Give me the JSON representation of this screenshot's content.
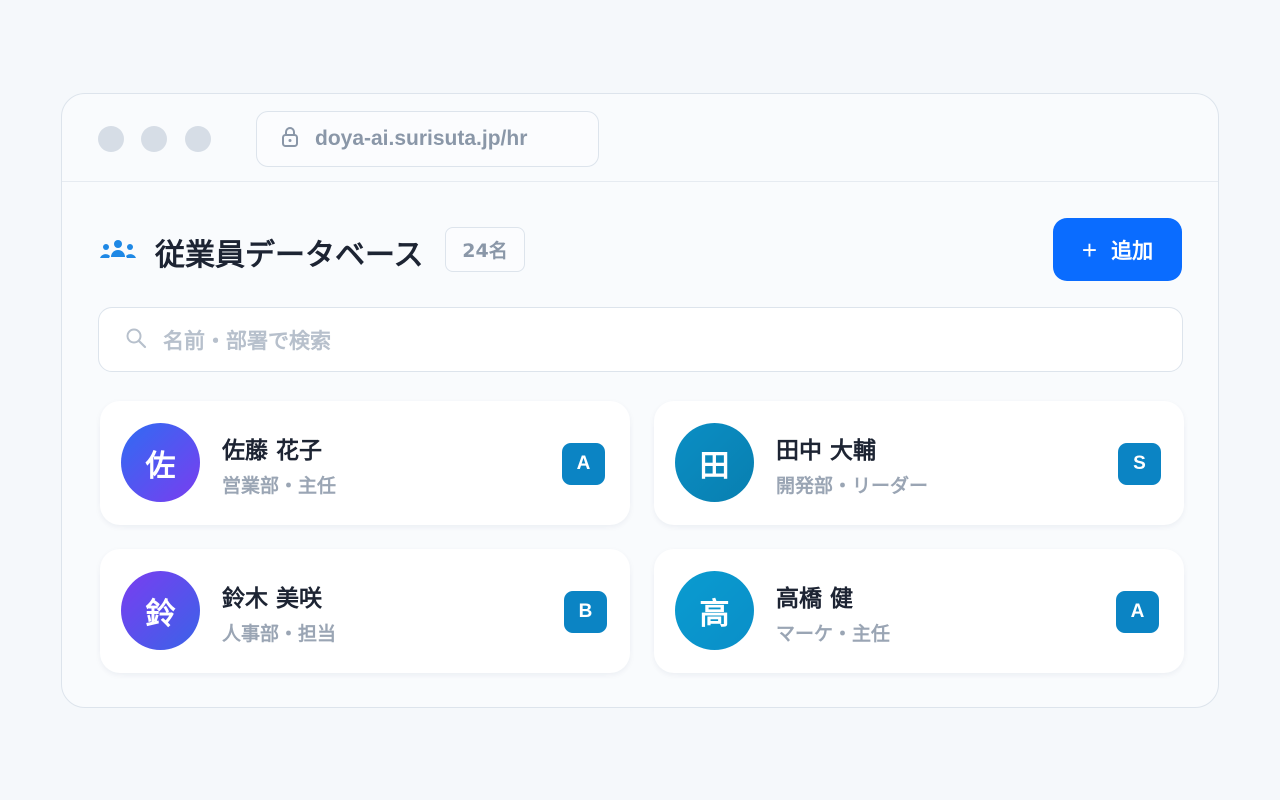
{
  "browser": {
    "url": "doya-ai.surisuta.jp/hr"
  },
  "header": {
    "title": "従業員データベース",
    "count": "24名",
    "add_button_icon": "+",
    "add_button_label": "追加"
  },
  "search": {
    "placeholder": "名前・部署で検索"
  },
  "colors": {
    "accent": "#0a6cff",
    "badge": "#0b84c4"
  },
  "employees": [
    {
      "initial": "佐",
      "name": "佐藤 花子",
      "role": "営業部・主任",
      "grade": "A",
      "avatar_gradient": [
        "#2f6cf2",
        "#7a3df0"
      ]
    },
    {
      "initial": "田",
      "name": "田中 大輔",
      "role": "開発部・リーダー",
      "grade": "S",
      "avatar_gradient": [
        "#0b8ec4",
        "#087fb0"
      ]
    },
    {
      "initial": "鈴",
      "name": "鈴木 美咲",
      "role": "人事部・担当",
      "grade": "B",
      "avatar_gradient": [
        "#7a3df0",
        "#3a63e8"
      ]
    },
    {
      "initial": "高",
      "name": "高橋 健",
      "role": "マーケ・主任",
      "grade": "A",
      "avatar_gradient": [
        "#0a9bd0",
        "#0a8fc8"
      ]
    }
  ]
}
